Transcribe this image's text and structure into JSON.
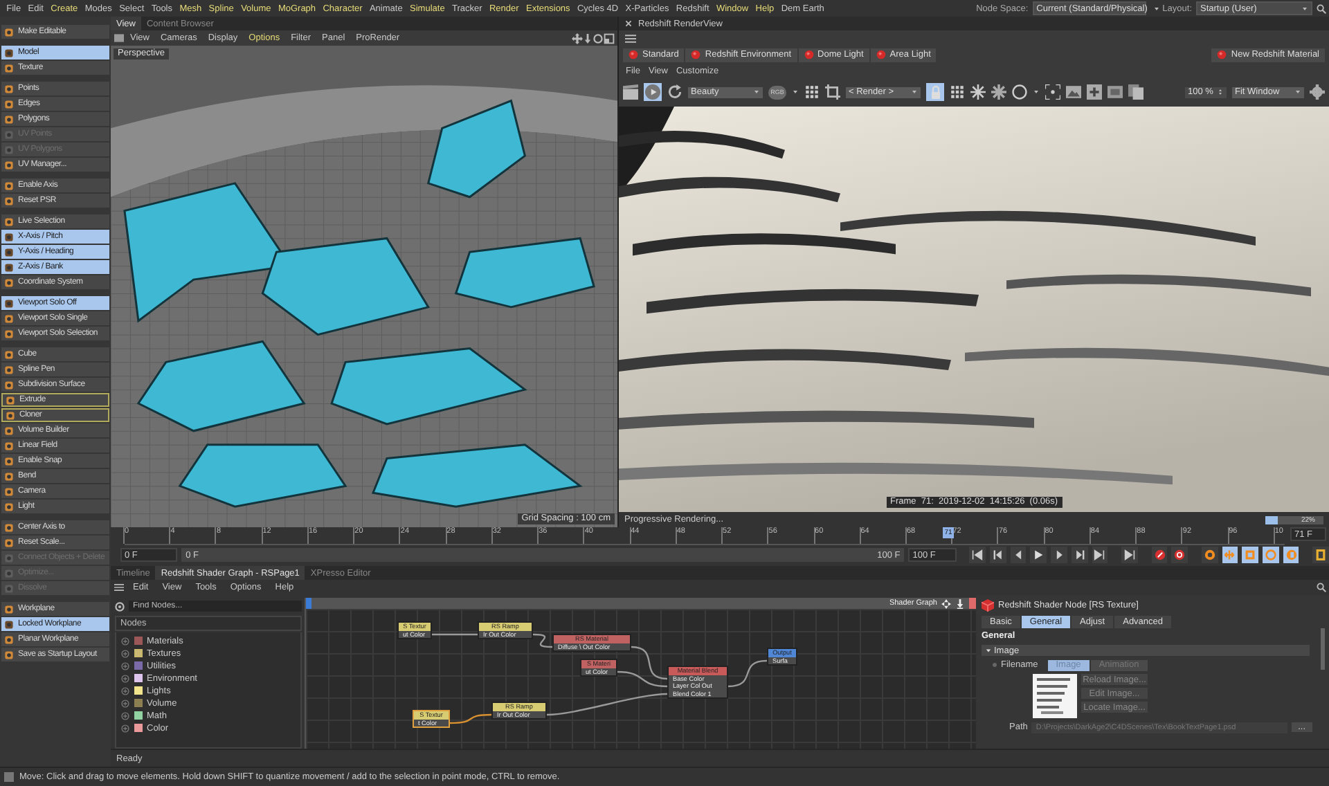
{
  "menu_bar": [
    {
      "label": "File",
      "highlight": false
    },
    {
      "label": "Edit",
      "highlight": false
    },
    {
      "label": "Create",
      "highlight": true
    },
    {
      "label": "Modes",
      "highlight": false
    },
    {
      "label": "Select",
      "highlight": false
    },
    {
      "label": "Tools",
      "highlight": false
    },
    {
      "label": "Mesh",
      "highlight": true
    },
    {
      "label": "Spline",
      "highlight": true
    },
    {
      "label": "Volume",
      "highlight": true
    },
    {
      "label": "MoGraph",
      "highlight": true
    },
    {
      "label": "Character",
      "highlight": true
    },
    {
      "label": "Animate",
      "highlight": false
    },
    {
      "label": "Simulate",
      "highlight": true
    },
    {
      "label": "Tracker",
      "highlight": false
    },
    {
      "label": "Render",
      "highlight": true
    },
    {
      "label": "Extensions",
      "highlight": true
    },
    {
      "label": "Cycles 4D",
      "highlight": false
    },
    {
      "label": "X-Particles",
      "highlight": false
    },
    {
      "label": "Redshift",
      "highlight": false
    },
    {
      "label": "Window",
      "highlight": true
    },
    {
      "label": "Help",
      "highlight": true
    },
    {
      "label": "Dem Earth",
      "highlight": false
    }
  ],
  "node_space": {
    "label": "Node Space:",
    "value": "Current (Standard/Physical)"
  },
  "layout": {
    "label": "Layout:",
    "value": "Startup (User)"
  },
  "tool_groups": [
    {
      "items": [
        {
          "label": "Make Editable",
          "selected": false,
          "disabled": false,
          "outlined": false
        }
      ]
    },
    {
      "items": [
        {
          "label": "Model",
          "selected": true,
          "disabled": false,
          "outlined": false
        },
        {
          "label": "Texture",
          "selected": false,
          "disabled": false,
          "outlined": false
        }
      ]
    },
    {
      "items": [
        {
          "label": "Points",
          "selected": false,
          "disabled": false,
          "outlined": false
        },
        {
          "label": "Edges",
          "selected": false,
          "disabled": false,
          "outlined": false
        },
        {
          "label": "Polygons",
          "selected": false,
          "disabled": false,
          "outlined": false
        },
        {
          "label": "UV Points",
          "selected": false,
          "disabled": true,
          "outlined": false
        },
        {
          "label": "UV Polygons",
          "selected": false,
          "disabled": true,
          "outlined": false
        },
        {
          "label": "UV Manager...",
          "selected": false,
          "disabled": false,
          "outlined": false
        }
      ]
    },
    {
      "items": [
        {
          "label": "Enable Axis",
          "selected": false,
          "disabled": false,
          "outlined": false
        },
        {
          "label": "Reset PSR",
          "selected": false,
          "disabled": false,
          "outlined": false
        }
      ]
    },
    {
      "items": [
        {
          "label": "Live Selection",
          "selected": false,
          "disabled": false,
          "outlined": false
        },
        {
          "label": "X-Axis / Pitch",
          "selected": true,
          "disabled": false,
          "outlined": false
        },
        {
          "label": "Y-Axis / Heading",
          "selected": true,
          "disabled": false,
          "outlined": false
        },
        {
          "label": "Z-Axis / Bank",
          "selected": true,
          "disabled": false,
          "outlined": false
        },
        {
          "label": "Coordinate System",
          "selected": false,
          "disabled": false,
          "outlined": false
        }
      ]
    },
    {
      "items": [
        {
          "label": "Viewport Solo Off",
          "selected": true,
          "disabled": false,
          "outlined": false
        },
        {
          "label": "Viewport Solo Single",
          "selected": false,
          "disabled": false,
          "outlined": false
        },
        {
          "label": "Viewport Solo Selection",
          "selected": false,
          "disabled": false,
          "outlined": false
        }
      ]
    },
    {
      "items": [
        {
          "label": "Cube",
          "selected": false,
          "disabled": false,
          "outlined": false
        },
        {
          "label": "Spline Pen",
          "selected": false,
          "disabled": false,
          "outlined": false
        },
        {
          "label": "Subdivision Surface",
          "selected": false,
          "disabled": false,
          "outlined": false
        },
        {
          "label": "Extrude",
          "selected": false,
          "disabled": false,
          "outlined": true
        },
        {
          "label": "Cloner",
          "selected": false,
          "disabled": false,
          "outlined": true
        },
        {
          "label": "Volume Builder",
          "selected": false,
          "disabled": false,
          "outlined": false
        },
        {
          "label": "Linear Field",
          "selected": false,
          "disabled": false,
          "outlined": false
        },
        {
          "label": "Enable Snap",
          "selected": false,
          "disabled": false,
          "outlined": false
        },
        {
          "label": "Bend",
          "selected": false,
          "disabled": false,
          "outlined": false
        },
        {
          "label": "Camera",
          "selected": false,
          "disabled": false,
          "outlined": false
        },
        {
          "label": "Light",
          "selected": false,
          "disabled": false,
          "outlined": false
        }
      ]
    },
    {
      "items": [
        {
          "label": "Center Axis to",
          "selected": false,
          "disabled": false,
          "outlined": false
        },
        {
          "label": "Reset Scale...",
          "selected": false,
          "disabled": false,
          "outlined": false
        },
        {
          "label": "Connect Objects + Delete",
          "selected": false,
          "disabled": true,
          "outlined": false
        },
        {
          "label": "Optimize...",
          "selected": false,
          "disabled": true,
          "outlined": false
        },
        {
          "label": "Dissolve",
          "selected": false,
          "disabled": true,
          "outlined": false
        }
      ]
    },
    {
      "items": [
        {
          "label": "Workplane",
          "selected": false,
          "disabled": false,
          "outlined": false
        },
        {
          "label": "Locked Workplane",
          "selected": true,
          "disabled": false,
          "outlined": false
        },
        {
          "label": "Planar Workplane",
          "selected": false,
          "disabled": false,
          "outlined": false
        },
        {
          "label": "Save as Startup Layout",
          "selected": false,
          "disabled": false,
          "outlined": false
        }
      ]
    }
  ],
  "viewport": {
    "tabs": [
      {
        "label": "View",
        "selected": true
      },
      {
        "label": "Content Browser",
        "selected": false
      }
    ],
    "menu": [
      {
        "label": "View",
        "highlight": false
      },
      {
        "label": "Cameras",
        "highlight": false
      },
      {
        "label": "Display",
        "highlight": false
      },
      {
        "label": "Options",
        "highlight": true
      },
      {
        "label": "Filter",
        "highlight": false
      },
      {
        "label": "Panel",
        "highlight": false
      },
      {
        "label": "ProRender",
        "highlight": false
      }
    ],
    "camera": "Perspective",
    "grid_spacing": "Grid Spacing : 100 cm"
  },
  "render_view": {
    "title": "Redshift RenderView",
    "presets": [
      "Standard",
      "Redshift Environment",
      "Dome Light",
      "Area Light"
    ],
    "new_material": "New Redshift Material",
    "menu": [
      "File",
      "View",
      "Customize"
    ],
    "toolbar": {
      "play_on": true,
      "aov": "Beauty",
      "channel": "RGB",
      "camera": "< Render >",
      "lock_on": true,
      "zoom": "100 %",
      "fit": "Fit Window"
    },
    "frame_info": "Frame  71:  2019-12-02  14:15:26  (0.06s)",
    "status": "Progressive Rendering...",
    "progress": {
      "level": 0.22,
      "label": "22%"
    }
  },
  "timeline": {
    "ticks": [
      "0",
      "4",
      "8",
      "12",
      "16",
      "20",
      "24",
      "28",
      "32",
      "36",
      "40",
      "44",
      "48",
      "52",
      "56",
      "60",
      "64",
      "68",
      "72",
      "76",
      "80",
      "84",
      "88",
      "92",
      "96",
      "10"
    ],
    "playhead": {
      "label": "71",
      "level": 0.71
    },
    "current": "71 F",
    "start": "0 F",
    "range_start": "0 F",
    "range_end": "100 F",
    "end": "100 F",
    "key_filters": [
      {
        "selected": true
      },
      {
        "selected": true
      },
      {
        "selected": true
      },
      {
        "selected": true
      }
    ]
  },
  "bottom": {
    "tabs": [
      {
        "label": "Timeline",
        "selected": false
      },
      {
        "label": "Redshift Shader Graph - RSPage1",
        "selected": true
      },
      {
        "label": "XPresso Editor",
        "selected": false
      }
    ],
    "menu": [
      "Edit",
      "View",
      "Tools",
      "Options",
      "Help"
    ],
    "search": {
      "placeholder": "Find Nodes..."
    },
    "nodes_header": "Nodes",
    "categories": [
      {
        "label": "Materials",
        "color": "#9c5858"
      },
      {
        "label": "Textures",
        "color": "#c9b872"
      },
      {
        "label": "Utilities",
        "color": "#7a6aa8"
      },
      {
        "label": "Environment",
        "color": "#dcc4ec"
      },
      {
        "label": "Lights",
        "color": "#f2e48c"
      },
      {
        "label": "Volume",
        "color": "#8c8052"
      },
      {
        "label": "Math",
        "color": "#92d2a2"
      },
      {
        "label": "Color",
        "color": "#ea9a9a"
      }
    ],
    "graph": {
      "title": "Shader Graph",
      "nodes": [
        {
          "title": "S Textur",
          "ports": [
            "ut Color"
          ],
          "color": "#d8cc72",
          "selected": false
        },
        {
          "title": "RS Ramp",
          "ports": [
            "Ir Out Color"
          ],
          "color": "#d8cc72",
          "selected": false
        },
        {
          "title": "RS Material",
          "ports": [
            "Diffuse \\ Out Color"
          ],
          "color": "#c06262",
          "selected": false
        },
        {
          "title": "S Materi",
          "ports": [
            "ut Color"
          ],
          "color": "#c06262",
          "selected": false
        },
        {
          "title": "Material Blend",
          "ports": [
            "Base Color",
            "Layer Col Out",
            "Blend Color 1"
          ],
          "color": "#c85a5a",
          "selected": false
        },
        {
          "title": "Output",
          "ports": [
            "Surfa"
          ],
          "color": "#4f86d6",
          "selected": false
        },
        {
          "title": "S Textur",
          "ports": [
            "t Color"
          ],
          "color": "#d8cc72",
          "selected": true
        },
        {
          "title": "RS Ramp",
          "ports": [
            "Ir Out Color"
          ],
          "color": "#d8cc72",
          "selected": false
        }
      ]
    },
    "status": "Ready",
    "inspector": {
      "title": "Redshift Shader Node [RS Texture]",
      "tabs": [
        {
          "label": "Basic",
          "selected": false
        },
        {
          "label": "General",
          "selected": true
        },
        {
          "label": "Adjust",
          "selected": false
        },
        {
          "label": "Advanced",
          "selected": false
        }
      ],
      "section": "General",
      "group": {
        "label": "Image",
        "expanded": true
      },
      "filename_label": "Filename",
      "source_tabs": [
        {
          "label": "Image",
          "selected": true
        },
        {
          "label": "Animation",
          "selected": false
        }
      ],
      "actions": [
        "Reload Image...",
        "Edit Image...",
        "Locate Image..."
      ],
      "path_label": "Path",
      "path": "D:\\Projects\\DarkAge2\\C4DScenes\\Tex\\BookTextPage1.psd",
      "browse": "..."
    }
  },
  "status_bar": "Move: Click and drag to move elements. Hold down SHIFT to quantize movement / add to the selection in point mode, CTRL to remove."
}
